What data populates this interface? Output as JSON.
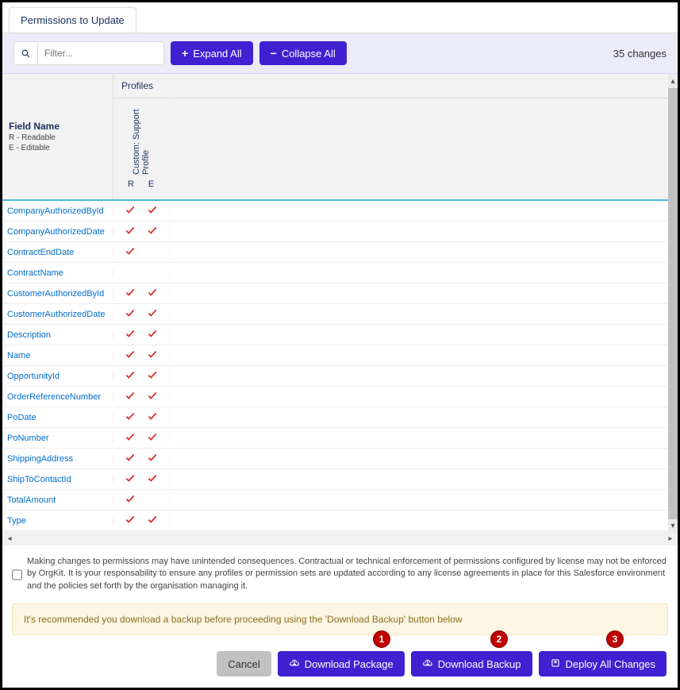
{
  "tab": {
    "title": "Permissions to Update"
  },
  "toolbar": {
    "filter_placeholder": "Filter...",
    "expand_label": "Expand All",
    "collapse_label": "Collapse All",
    "changes_count": "35 changes"
  },
  "table": {
    "fieldname_header": "Field Name",
    "fieldname_sub_r": "R - Readable",
    "fieldname_sub_e": "E - Editable",
    "profiles_header": "Profiles",
    "profile_name": "Custom: Support Profile",
    "col_r": "R",
    "col_e": "E",
    "rows": [
      {
        "name": "CompanyAuthorizedById",
        "r": true,
        "e": true
      },
      {
        "name": "CompanyAuthorizedDate",
        "r": true,
        "e": true
      },
      {
        "name": "ContractEndDate",
        "r": true,
        "e": false
      },
      {
        "name": "ContractName",
        "r": false,
        "e": false
      },
      {
        "name": "CustomerAuthorizedById",
        "r": true,
        "e": true
      },
      {
        "name": "CustomerAuthorizedDate",
        "r": true,
        "e": true
      },
      {
        "name": "Description",
        "r": true,
        "e": true
      },
      {
        "name": "Name",
        "r": true,
        "e": true
      },
      {
        "name": "OpportunityId",
        "r": true,
        "e": true
      },
      {
        "name": "OrderReferenceNumber",
        "r": true,
        "e": true
      },
      {
        "name": "PoDate",
        "r": true,
        "e": true
      },
      {
        "name": "PoNumber",
        "r": true,
        "e": true
      },
      {
        "name": "ShippingAddress",
        "r": true,
        "e": true
      },
      {
        "name": "ShipToContactId",
        "r": true,
        "e": true
      },
      {
        "name": "TotalAmount",
        "r": true,
        "e": false
      },
      {
        "name": "Type",
        "r": true,
        "e": true
      }
    ]
  },
  "disclaimer": "Making changes to permissions may have unintended consequences. Contractual or technical enforcement of permissions configured by license may not be enforced by OrgKit. It is your responsability to ensure any profiles or permission sets are updated according to any license agreements in place for this Salesforce environment and the policies set forth by the organisation managing it.",
  "warning": "It's recommended you download a backup before proceeding using the 'Download Backup' button below",
  "footer": {
    "cancel": "Cancel",
    "download_package": "Download Package",
    "download_backup": "Download Backup",
    "deploy": "Deploy All Changes"
  },
  "markers": {
    "m1": "1",
    "m2": "2",
    "m3": "3"
  }
}
